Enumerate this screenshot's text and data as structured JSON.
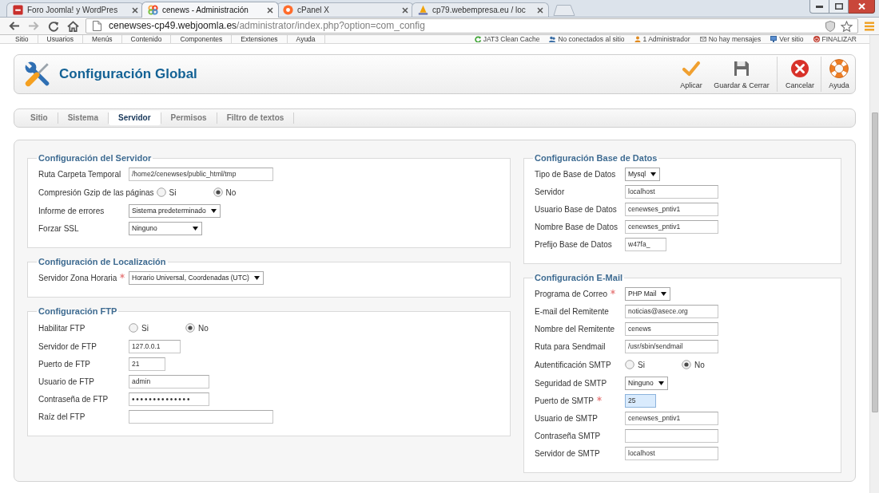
{
  "browser": {
    "tabs": [
      {
        "title": "Foro Joomla! y WordPres",
        "kind": "tile",
        "selected": false
      },
      {
        "title": "cenews - Administración",
        "kind": "petals",
        "selected": true
      },
      {
        "title": "cPanel X",
        "kind": "ring",
        "selected": false
      },
      {
        "title": "cp79.webempresa.eu / loc",
        "kind": "sail",
        "selected": false
      }
    ],
    "address": {
      "host": "cenewses-cp49.webjoomla.es",
      "path": "/administrator/index.php?option=com_config"
    }
  },
  "admin_menu": {
    "items": [
      "Sitio",
      "Usuarios",
      "Menús",
      "Contenido",
      "Componentes",
      "Extensiones",
      "Ayuda"
    ],
    "status": [
      {
        "label": "JAT3 Clean Cache",
        "kind": "refresh"
      },
      {
        "label": "No conectados al sitio",
        "kind": "users"
      },
      {
        "label": "1 Administrador",
        "kind": "user"
      },
      {
        "label": "No hay mensajes",
        "kind": "mail"
      },
      {
        "label": "Ver sitio",
        "kind": "monitor"
      },
      {
        "label": "FINALIZAR",
        "kind": "power"
      }
    ]
  },
  "toolbar": {
    "title": "Configuración Global",
    "buttons": [
      {
        "label": "Aplicar",
        "kind": "apply"
      },
      {
        "label": "Guardar & Cerrar",
        "kind": "save"
      },
      {
        "label": "Cancelar",
        "kind": "cancel"
      },
      {
        "label": "Ayuda",
        "kind": "help"
      }
    ]
  },
  "tabs": [
    {
      "label": "Sitio",
      "selected": false
    },
    {
      "label": "Sistema",
      "selected": false
    },
    {
      "label": "Servidor",
      "selected": true
    },
    {
      "label": "Permisos",
      "selected": false
    },
    {
      "label": "Filtro de textos",
      "selected": false
    }
  ],
  "left_sections": [
    {
      "title": "Configuración del Servidor",
      "fields": [
        {
          "label": "Ruta Carpeta Temporal",
          "kind": "text",
          "value": "/home2/cenewses/public_html/tmp",
          "required": false,
          "focused": false
        },
        {
          "label": "Compresión Gzip de las páginas",
          "kind": "radio",
          "options": [
            {
              "label": "Si",
              "selected": false
            },
            {
              "label": "No",
              "selected": true
            }
          ],
          "required": false,
          "focused": false
        },
        {
          "label": "Informe de errores",
          "kind": "select",
          "value": "Sistema predeterminado",
          "required": false,
          "focused": false
        },
        {
          "label": "Forzar SSL",
          "kind": "select",
          "value": "Ninguno",
          "required": false,
          "focused": false
        }
      ]
    },
    {
      "title": "Configuración de Localización",
      "fields": [
        {
          "label": "Servidor Zona Horaria",
          "kind": "select",
          "value": "Horario Universal, Coordenadas (UTC)",
          "required": true,
          "focused": false
        }
      ]
    },
    {
      "title": "Configuración FTP",
      "fields": [
        {
          "label": "Habilitar FTP",
          "kind": "radio",
          "options": [
            {
              "label": "Si",
              "selected": false
            },
            {
              "label": "No",
              "selected": true
            }
          ],
          "required": false,
          "focused": false
        },
        {
          "label": "Servidor de FTP",
          "kind": "text",
          "value": "127.0.0.1",
          "required": false,
          "focused": false
        },
        {
          "label": "Puerto de FTP",
          "kind": "text",
          "value": "21",
          "required": false,
          "focused": false
        },
        {
          "label": "Usuario de FTP",
          "kind": "text",
          "value": "admin",
          "required": false,
          "focused": false
        },
        {
          "label": "Contraseña de FTP",
          "kind": "password",
          "value": "••••••••••••••",
          "required": false,
          "focused": false
        },
        {
          "label": "Raíz del FTP",
          "kind": "text",
          "required": false,
          "focused": false
        }
      ]
    }
  ],
  "right_sections": [
    {
      "title": "Configuración Base de Datos",
      "fields": [
        {
          "label": "Tipo de Base de Datos",
          "kind": "select",
          "value": "Mysql",
          "required": false,
          "focused": false
        },
        {
          "label": "Servidor",
          "kind": "text",
          "value": "localhost",
          "required": false,
          "focused": false
        },
        {
          "label": "Usuario Base de Datos",
          "kind": "text",
          "value": "cenewses_pntiv1",
          "required": false,
          "focused": false
        },
        {
          "label": "Nombre Base de Datos",
          "kind": "text",
          "value": "cenewses_pntiv1",
          "required": false,
          "focused": false
        },
        {
          "label": "Prefijo Base de Datos",
          "kind": "text",
          "value": "w47fa_",
          "required": false,
          "focused": false
        }
      ]
    },
    {
      "title": "Configuración E-Mail",
      "fields": [
        {
          "label": "Programa de Correo",
          "kind": "select",
          "value": "PHP Mail",
          "required": true,
          "focused": false
        },
        {
          "label": "E-mail del Remitente",
          "kind": "text",
          "value": "noticias@asece.org",
          "required": false,
          "focused": false
        },
        {
          "label": "Nombre del Remitente",
          "kind": "text",
          "value": "cenews",
          "required": false,
          "focused": false
        },
        {
          "label": "Ruta para Sendmail",
          "kind": "text",
          "value": "/usr/sbin/sendmail",
          "required": false,
          "focused": false
        },
        {
          "label": "Autentificación SMTP",
          "kind": "radio",
          "options": [
            {
              "label": "Si",
              "selected": false
            },
            {
              "label": "No",
              "selected": true
            }
          ],
          "required": false,
          "focused": false
        },
        {
          "label": "Seguridad de SMTP",
          "kind": "select",
          "value": "Ninguno",
          "required": false,
          "focused": false
        },
        {
          "label": "Puerto de SMTP",
          "kind": "text",
          "value": "25",
          "required": true,
          "focused": true
        },
        {
          "label": "Usuario de SMTP",
          "kind": "text",
          "value": "cenewses_pntiv1",
          "required": false,
          "focused": false
        },
        {
          "label": "Contraseña SMTP",
          "kind": "password",
          "required": false,
          "focused": false
        },
        {
          "label": "Servidor de SMTP",
          "kind": "text",
          "value": "localhost",
          "required": false,
          "focused": false
        }
      ]
    }
  ]
}
